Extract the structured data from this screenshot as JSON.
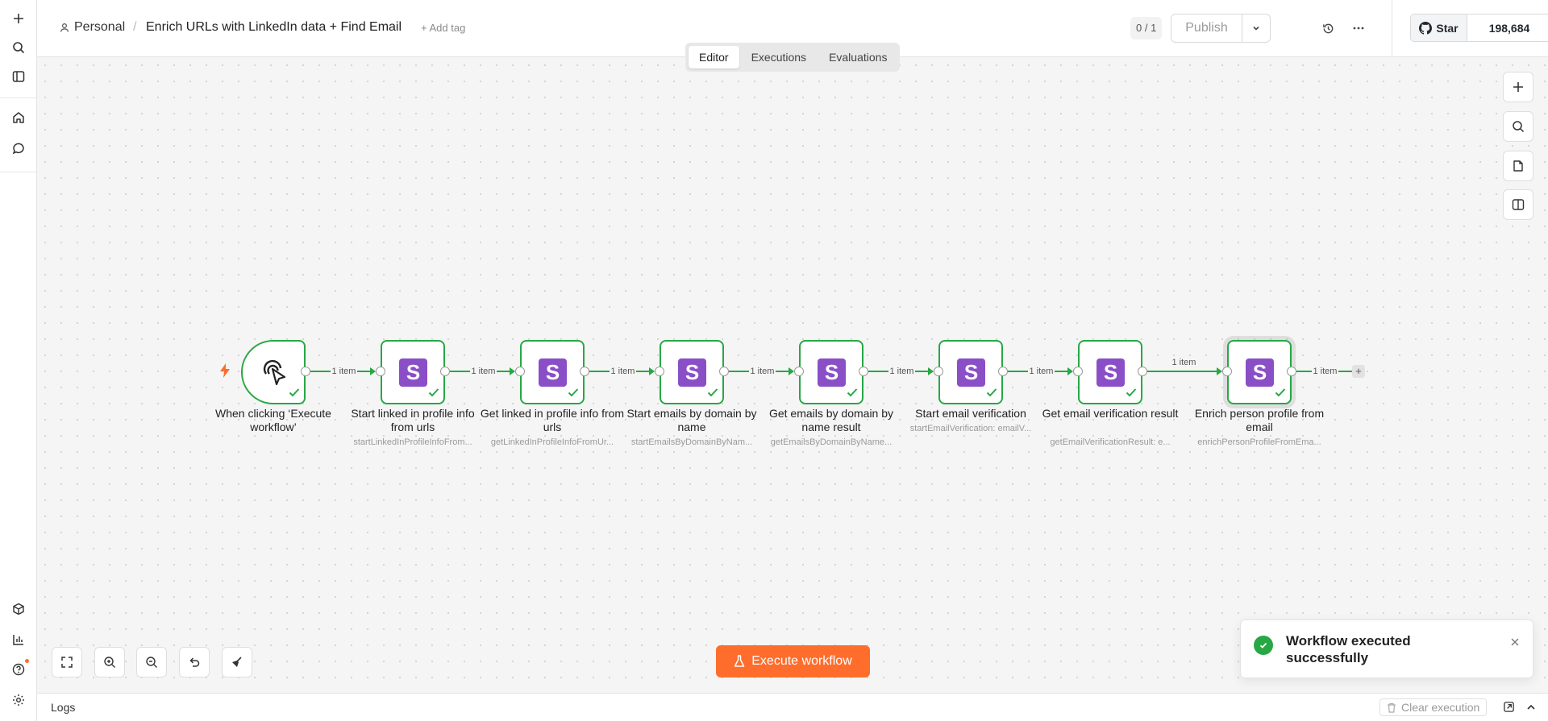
{
  "header": {
    "project": "Personal",
    "separator": "/",
    "workflow_name": "Enrich URLs with LinkedIn data + Find Email",
    "add_tag": "+ Add tag",
    "counter": "0 / 1",
    "publish_label": "Publish"
  },
  "github": {
    "star_label": "Star",
    "star_count": "198,684"
  },
  "tabs": [
    {
      "label": "Editor",
      "active": true
    },
    {
      "label": "Executions",
      "active": false
    },
    {
      "label": "Evaluations",
      "active": false
    }
  ],
  "nodes": [
    {
      "title": "When clicking ‘Execute workflow’",
      "subtitle": "",
      "type": "trigger"
    },
    {
      "title": "Start linked in profile info from urls",
      "subtitle": "startLinkedInProfileInfoFrom...",
      "type": "action"
    },
    {
      "title": "Get linked in profile info from urls",
      "subtitle": "getLinkedInProfileInfoFromUr...",
      "type": "action"
    },
    {
      "title": "Start emails by domain by name",
      "subtitle": "startEmailsByDomainByNam...",
      "type": "action"
    },
    {
      "title": "Get emails by domain by name result",
      "subtitle": "getEmailsByDomainByName...",
      "type": "action"
    },
    {
      "title": "Start email verification",
      "subtitle": "startEmailVerification: emailV...",
      "type": "action"
    },
    {
      "title": "Get email verification result",
      "subtitle": "getEmailVerificationResult: e...",
      "type": "action"
    },
    {
      "title": "Enrich person profile from email",
      "subtitle": "enrichPersonProfileFromEma...",
      "type": "action"
    }
  ],
  "edges": [
    {
      "label": "1 item"
    },
    {
      "label": "1 item"
    },
    {
      "label": "1 item"
    },
    {
      "label": "1 item"
    },
    {
      "label": "1 item"
    },
    {
      "label": "1 item"
    },
    {
      "label": "1 item"
    },
    {
      "label": "1 item"
    }
  ],
  "node_logo_letter": "S",
  "execute_button": "Execute workflow",
  "toast": {
    "message": "Workflow executed successfully"
  },
  "logs": {
    "title": "Logs",
    "clear_label": "Clear execution"
  },
  "colors": {
    "success": "#27a844",
    "accent": "#ff6d2c",
    "node_logo": "#8a4fc7"
  }
}
